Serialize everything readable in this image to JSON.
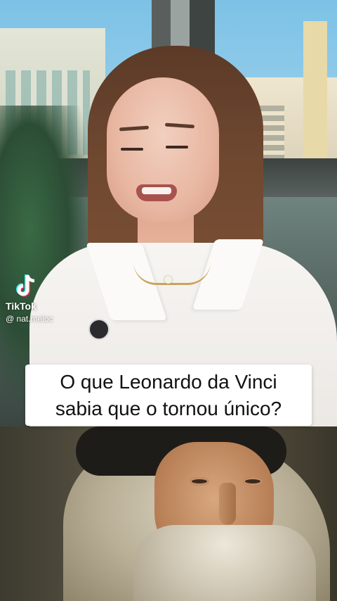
{
  "watermark": {
    "brand": "TikTok",
    "username": "@ nat.meloc",
    "icon": "tiktok-logo-icon"
  },
  "caption": {
    "line1": "O que Leonardo da Vinci",
    "line2": "sabia que o tornou único?"
  },
  "colors": {
    "caption_background": "#ffffff",
    "caption_text": "#111111",
    "watermark_text": "#ffffff"
  }
}
